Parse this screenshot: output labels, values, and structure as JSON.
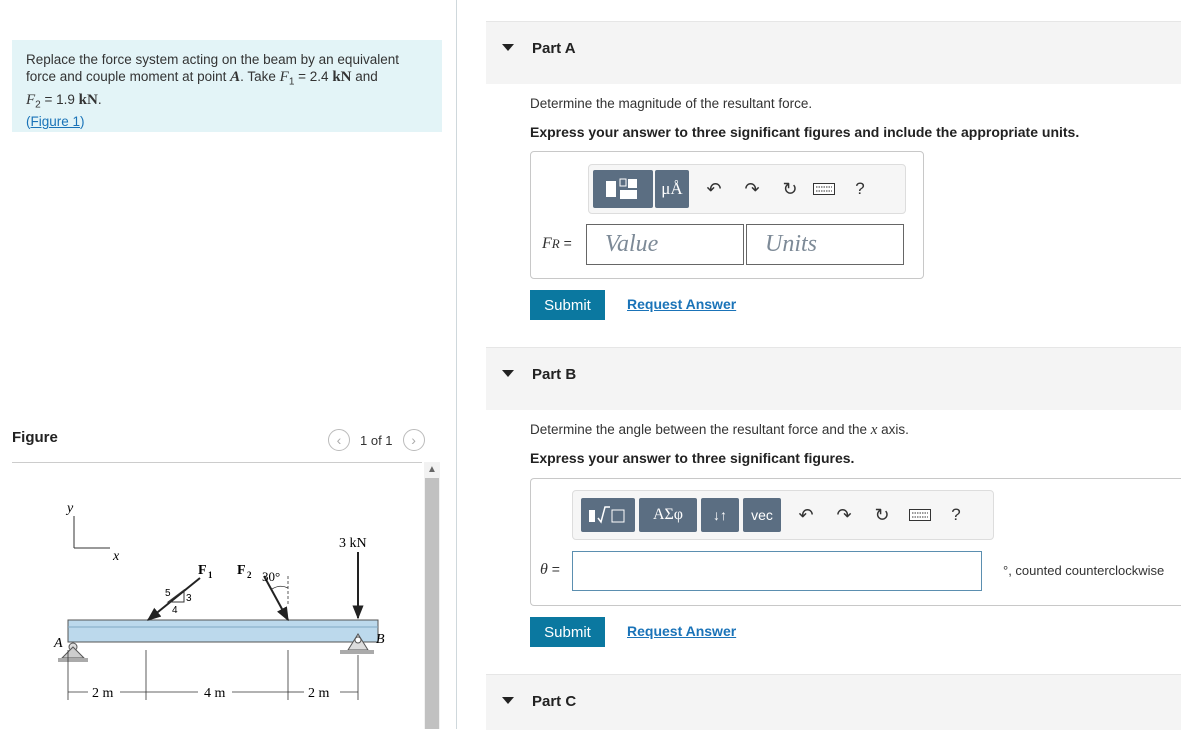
{
  "problem": {
    "text_1": "Replace the force system acting on the beam by an equivalent",
    "text_2": "force and couple moment at point ",
    "point": "A",
    "text_3": ". Take ",
    "f1_symbol": "F",
    "f1_sub": "1",
    "f1_value": " = 2.4 ",
    "unit": "kN",
    "text_and": " and",
    "f2_symbol": "F",
    "f2_sub": "2",
    "f2_value": " = 1.9 ",
    "period": ".",
    "figure_link_open": "(",
    "figure_link": "Figure 1",
    "figure_link_close": ")"
  },
  "figure": {
    "title": "Figure",
    "pager_text": "1 of 1",
    "prev_icon": "chevron-left-icon",
    "next_icon": "chevron-right-icon",
    "labels": {
      "y": "y",
      "x": "x",
      "F1": "F",
      "F1_sub": "1",
      "F2": "F",
      "F2_sub": "2",
      "angle": "30°",
      "load": "3 kN",
      "tri_5": "5",
      "tri_3": "3",
      "tri_4": "4",
      "A": "A",
      "B": "B",
      "d1": "2 m",
      "d2": "4 m",
      "d3": "2 m"
    }
  },
  "partA": {
    "label": "Part A",
    "question": "Determine the magnitude of the resultant force.",
    "instruction": "Express your answer to three significant figures and include the appropriate units.",
    "toolbar": {
      "templates_icon": "templates-icon",
      "units_symbol": "μÅ",
      "undo_icon": "undo-icon",
      "redo_icon": "redo-icon",
      "reset_icon": "reset-icon",
      "keyboard_icon": "keyboard-icon",
      "help": "?"
    },
    "var_main": "F",
    "var_sub": "R",
    "equals": "=",
    "value_placeholder": "Value",
    "units_placeholder": "Units",
    "submit": "Submit",
    "request": "Request Answer"
  },
  "partB": {
    "label": "Part B",
    "question_1": "Determine the angle between the resultant force and the ",
    "question_x": "x",
    "question_2": " axis.",
    "instruction": "Express your answer to three significant figures.",
    "toolbar": {
      "templates_icon": "templates-icon",
      "greek": "ΑΣφ",
      "arrows": "↓↑",
      "vec": "vec",
      "undo_icon": "undo-icon",
      "redo_icon": "redo-icon",
      "reset_icon": "reset-icon",
      "keyboard_icon": "keyboard-icon",
      "help": "?"
    },
    "var": "θ",
    "equals": "=",
    "suffix": "°, counted counterclockwise",
    "submit": "Submit",
    "request": "Request Answer"
  },
  "partC": {
    "label": "Part C"
  },
  "colors": {
    "submit": "#0b78a0",
    "link": "#1a73b8",
    "problem_bg": "#e3f4f7",
    "beam": "#bcd9ec"
  }
}
